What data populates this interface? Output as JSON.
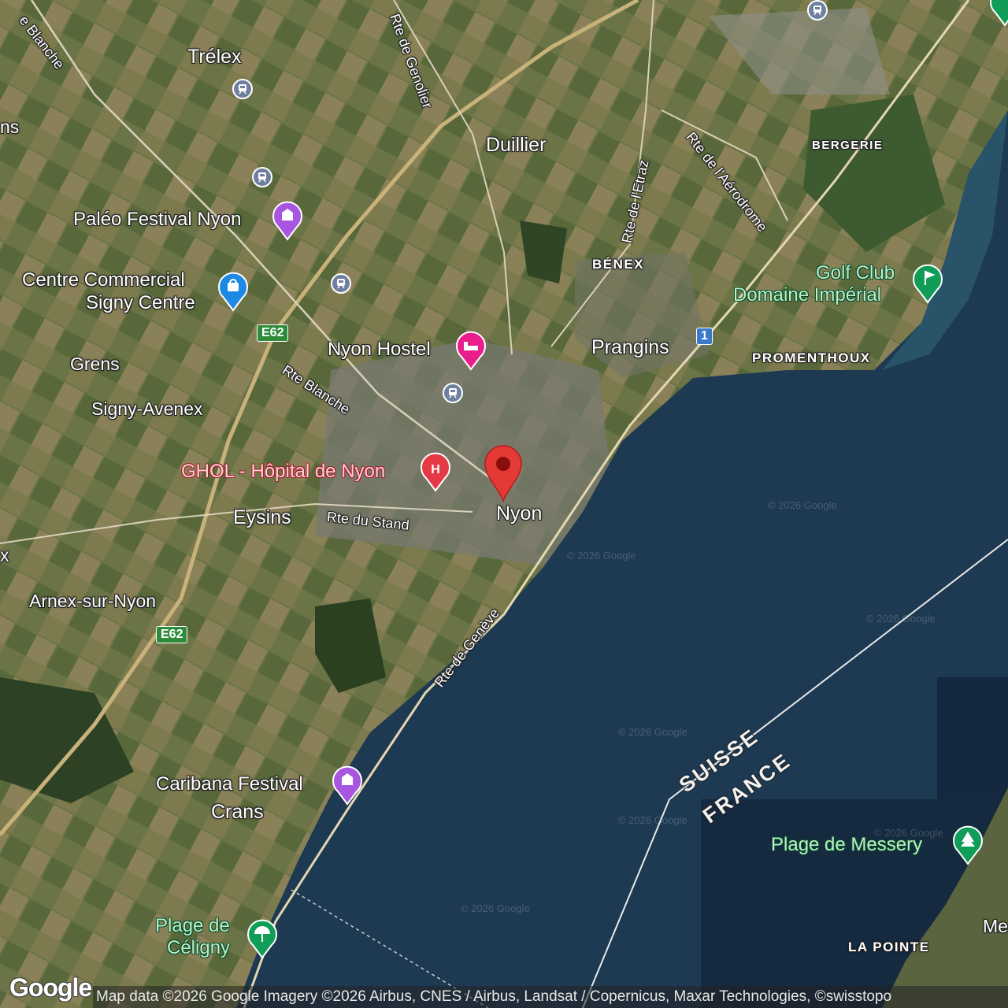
{
  "map": {
    "places": {
      "trelex": "Trélex",
      "duillier": "Duillier",
      "benex": "BÉNEX",
      "bergerie": "BERGERIE",
      "prangins": "Prangins",
      "promenthoux": "PROMENTHOUX",
      "grens": "Grens",
      "signy_avenex": "Signy-Avenex",
      "eysins": "Eysins",
      "nyon": "Nyon",
      "arnex": "Arnex-sur-Nyon",
      "crans": "Crans",
      "la_pointe": "LA POINTE",
      "ns_partial": "ns",
      "me_partial": "Me",
      "x_partial": "x"
    },
    "roads": {
      "rte_blanche_top": "e Blanche",
      "rte_genolier": "Rte de Genolier",
      "rte_aerodrome": "Rte de l'Aérodrome",
      "rte_etraz": "Rte de l'Etraz",
      "rte_blanche": "Rte Blanche",
      "rte_stand": "Rte du Stand",
      "rte_geneve": "Rte de Genève"
    },
    "shields": {
      "e62_a": "E62",
      "e62_b": "E62",
      "n1": "1"
    },
    "border": {
      "suisse": "SUISSE",
      "france": "FRANCE"
    },
    "pois": {
      "paleo": "Paléo Festival Nyon",
      "signy_centre_1": "Centre Commercial",
      "signy_centre_2": "Signy Centre",
      "hostel": "Nyon Hostel",
      "hospital": "GHOL - Hôpital de Nyon",
      "golf_1": "Golf Club",
      "golf_2": "Domaine Impérial",
      "caribana": "Caribana Festival",
      "celigny_1": "Plage de",
      "celigny_2": "Céligny",
      "messery": "Plage de Messery"
    },
    "watermark": "© 2026 Google",
    "attribution": "Map data ©2026 Google Imagery ©2026 Airbus, CNES / Airbus, Landsat / Copernicus, Maxar Technologies, ©swisstopo",
    "logo": "Google",
    "colors": {
      "lake": "#1d3a52",
      "land": "#5e6b40",
      "marker": "#e53935",
      "purple": "#a855e0",
      "blue": "#1e88e5",
      "pink": "#e91e8c",
      "red": "#e53945",
      "green": "#0f9d58"
    }
  }
}
